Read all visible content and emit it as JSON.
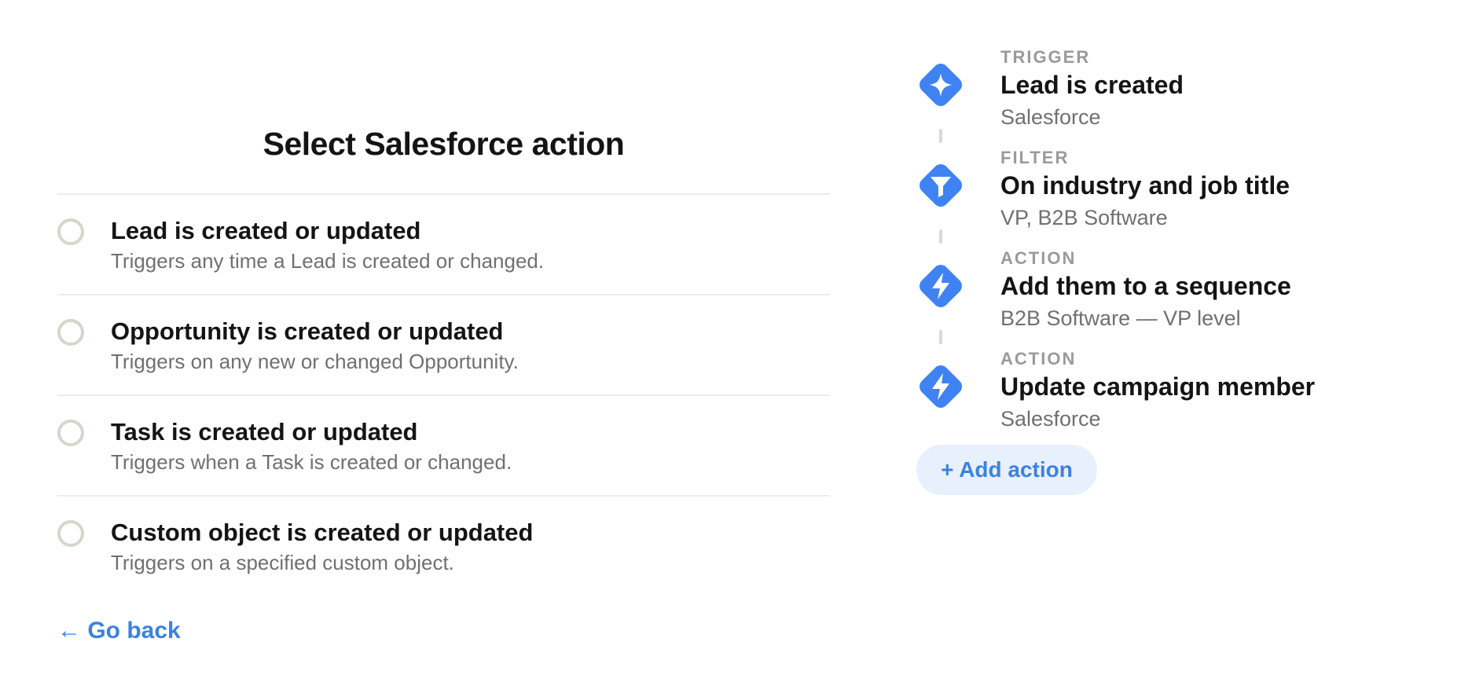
{
  "selector": {
    "title": "Select Salesforce action",
    "options": [
      {
        "title": "Lead is created or updated",
        "description": "Triggers any time a Lead is created or changed."
      },
      {
        "title": "Opportunity is created or updated",
        "description": "Triggers on any new or changed Opportunity."
      },
      {
        "title": "Task is created or updated",
        "description": "Triggers when a Task is created or changed."
      },
      {
        "title": "Custom object is created or updated",
        "description": "Triggers on a specified custom object."
      }
    ],
    "go_back": "← Go back"
  },
  "workflow": {
    "steps": [
      {
        "kind": "TRIGGER",
        "title": "Lead is created",
        "subtitle": "Salesforce",
        "icon": "sparkle-icon"
      },
      {
        "kind": "FILTER",
        "title": "On industry and job title",
        "subtitle": "VP, B2B Software",
        "icon": "funnel-icon"
      },
      {
        "kind": "ACTION",
        "title": "Add them to a sequence",
        "subtitle": "B2B Software — VP level",
        "icon": "lightning-icon"
      },
      {
        "kind": "ACTION",
        "title": "Update campaign member",
        "subtitle": "Salesforce",
        "icon": "lightning-icon"
      }
    ],
    "add_action": "+ Add action"
  },
  "colors": {
    "accent": "#3b82e0",
    "icon_blue": "#3f83f3",
    "radio_border": "#d7d5cc",
    "divider": "#ececec",
    "muted_text": "#707070"
  }
}
